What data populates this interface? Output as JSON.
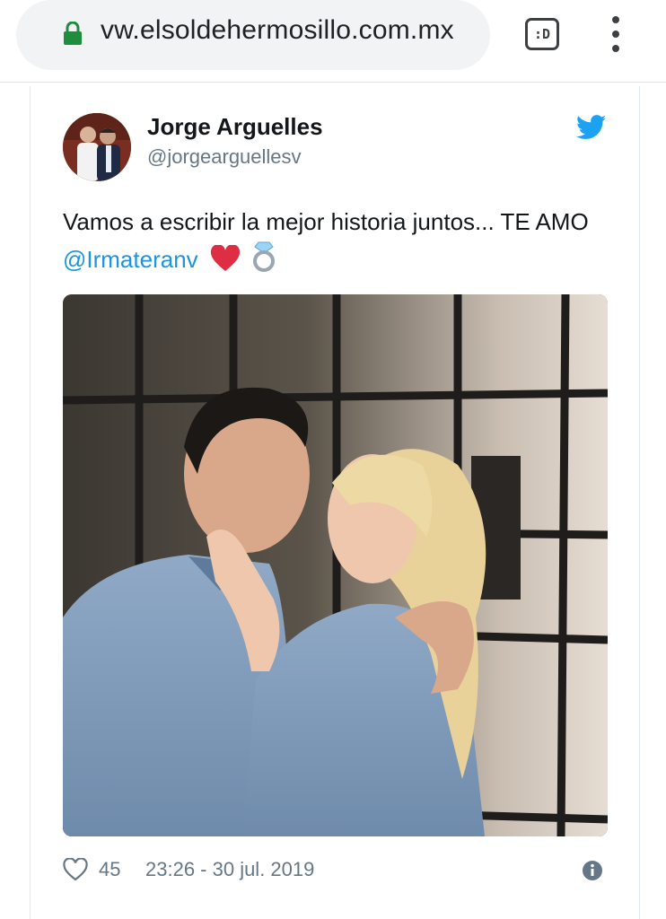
{
  "browser": {
    "url": "vw.elsoldehermosillo.com.mx",
    "tab_button_label": ":D",
    "lock_icon": "lock-icon",
    "menu_icon": "kebab-menu-icon"
  },
  "tweet": {
    "author_name": "Jorge Arguelles",
    "author_handle": "@jorgearguellesv",
    "text": "Vamos a escribir la mejor historia juntos... TE AMO ",
    "mention": "@Irmateranv",
    "emojis": [
      "heart-emoji",
      "ring-emoji"
    ],
    "likes": "45",
    "timestamp": "23:26 - 30 jul. 2019",
    "brand_icon": "twitter-bird-icon",
    "colors": {
      "link": "#1b95e0",
      "secondary_text": "#657786",
      "twitter_blue": "#1da1f2",
      "lock_green": "#1e8e3e"
    }
  }
}
